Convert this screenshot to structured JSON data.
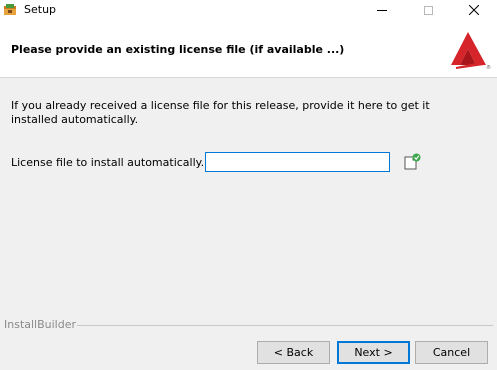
{
  "window": {
    "title": "Setup"
  },
  "header": {
    "title": "Please provide an existing license file (if available ...)"
  },
  "main": {
    "description": "If you already received a license file for this release, provide it here to get it installed automatically.",
    "field_label": "License file to install automatically.",
    "field_value": ""
  },
  "footer": {
    "brand": "InstallBuilder",
    "back_label": "< Back",
    "next_label": "Next >",
    "cancel_label": "Cancel"
  },
  "colors": {
    "accent": "#0078d7",
    "logo_red": "#d5242a",
    "background": "#f0f0f0"
  },
  "icons": {
    "app": "installer-icon",
    "browse": "open-file-icon",
    "logo": "triangle-logo-icon"
  }
}
